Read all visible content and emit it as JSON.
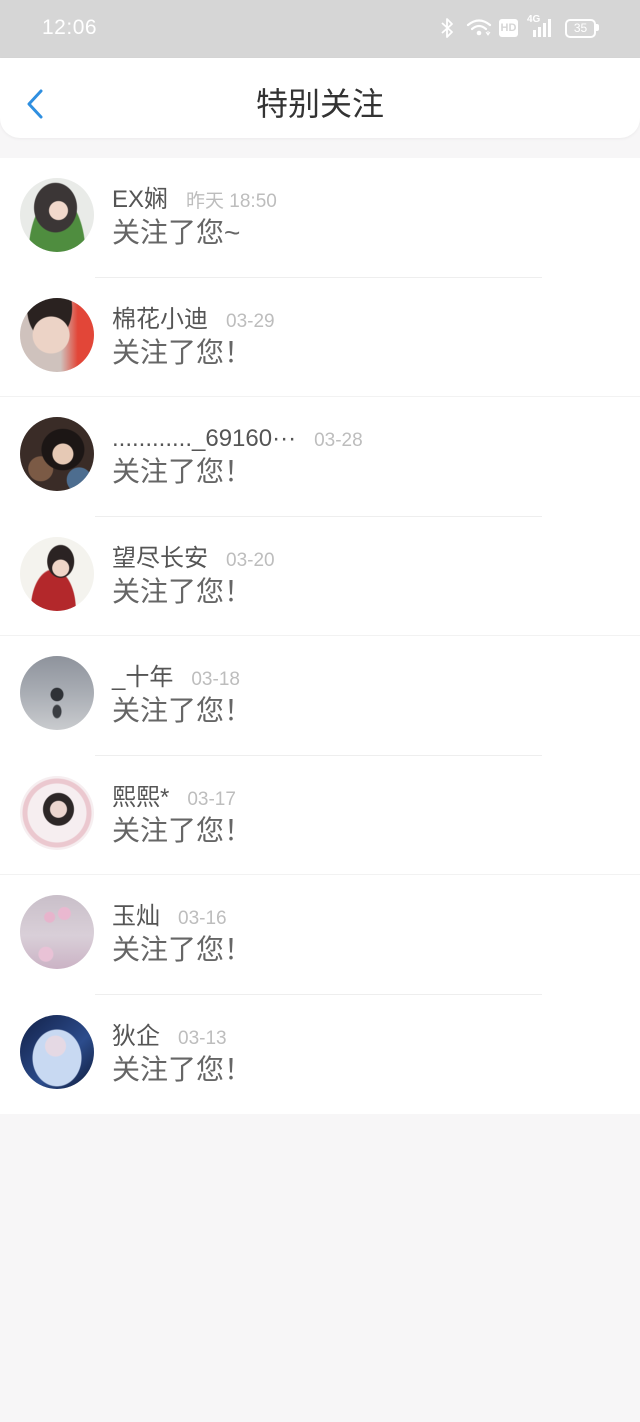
{
  "status_bar": {
    "time": "12:06",
    "hd": "HD",
    "network": "4G",
    "battery": "35",
    "icons": [
      "bluetooth-icon",
      "wifi-icon",
      "hd-icon",
      "signal-icon",
      "battery-icon"
    ]
  },
  "nav": {
    "title": "特别关注",
    "back_icon": "back-chevron-icon"
  },
  "list": [
    {
      "name": "EX娴",
      "time": "昨天 18:50",
      "message": "关注了您~"
    },
    {
      "name": "棉花小迪",
      "time": "03-29",
      "message": "关注了您！"
    },
    {
      "name": "............_69160···",
      "time": "03-28",
      "message": "关注了您！"
    },
    {
      "name": "望尽长安",
      "time": "03-20",
      "message": "关注了您！"
    },
    {
      "name": "_十年",
      "time": "03-18",
      "message": "关注了您！"
    },
    {
      "name": "熙熙*",
      "time": "03-17",
      "message": "关注了您！"
    },
    {
      "name": "玉灿",
      "time": "03-16",
      "message": "关注了您！"
    },
    {
      "name": "狄企",
      "time": "03-13",
      "message": "关注了您！"
    }
  ],
  "colors": {
    "accent": "#2f8fe0",
    "status_bar_bg": "#d6d6d6",
    "page_bg": "#f7f6f7",
    "title_text": "#333333",
    "timestamp_text": "#bdbdbd"
  }
}
